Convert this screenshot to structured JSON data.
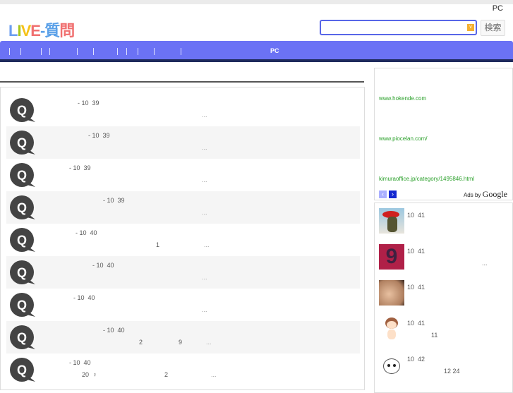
{
  "header": {
    "pc_link": "PC",
    "logo": "LIVE-質問",
    "search_value": "",
    "search_button": "検索"
  },
  "nav": {
    "pc": "PC"
  },
  "questions": [
    {
      "meta": "- 10  39",
      "line2": [
        "..."
      ]
    },
    {
      "meta": "- 10  39",
      "line2": [
        "..."
      ]
    },
    {
      "meta": "- 10  39",
      "line2": [
        "..."
      ]
    },
    {
      "meta": "- 10  39",
      "line2": [
        "..."
      ]
    },
    {
      "meta": "- 10  40",
      "line2": [
        "1",
        "..."
      ]
    },
    {
      "meta": "- 10  40",
      "line2": [
        "..."
      ]
    },
    {
      "meta": "- 10  40",
      "line2": [
        "..."
      ]
    },
    {
      "meta": "- 10  40",
      "line2": [
        "2",
        "9",
        "..."
      ]
    },
    {
      "meta": "- 10  40",
      "line2": [
        "20  ♀",
        "2",
        "..."
      ]
    }
  ],
  "ads": {
    "urls": [
      "www.hokende.com",
      "www.piocelan.com/",
      "kimuraoffice.jp/category/1495846.html"
    ],
    "prev": "‹",
    "next": "›",
    "ads_by": "Ads by",
    "google": "Google"
  },
  "recent": [
    {
      "meta": "10  41",
      "line2": ""
    },
    {
      "meta": "10  41",
      "line2": "..."
    },
    {
      "meta": "10  41",
      "line2": ""
    },
    {
      "meta": "10  41",
      "line2": "11"
    },
    {
      "meta": "10  42",
      "line2": "12 24"
    }
  ],
  "colors": {
    "nav": "#6b72f5",
    "nav_under": "#1e2a5c",
    "ad_link": "#2aa02a"
  }
}
